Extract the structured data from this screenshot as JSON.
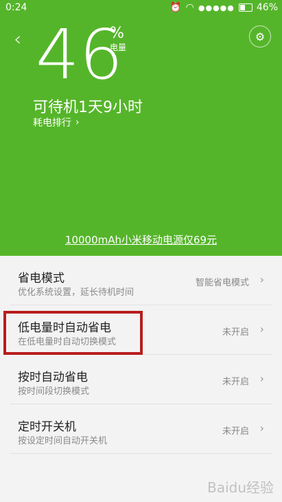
{
  "status_bar": {
    "time": "0:24",
    "signal_dots": "●●●●●",
    "battery": "46%"
  },
  "hero": {
    "battery_level": "46",
    "percent_sign": "%",
    "percent_label": "电量",
    "standby_time": "可待机1天9小时",
    "rank_link": "耗电排行",
    "promo": "10000mAh小米移动电源仅69元"
  },
  "list": [
    {
      "title": "省电模式",
      "sub": "优化系统设置，延长待机时间",
      "value": "智能省电模式"
    },
    {
      "title": "低电量时自动省电",
      "sub": "在低电量时自动切换模式",
      "value": "未开启"
    },
    {
      "title": "按时自动省电",
      "sub": "按时间段切换模式",
      "value": "未开启"
    },
    {
      "title": "定时开关机",
      "sub": "按设定时间自动开关机",
      "value": "未开启"
    }
  ],
  "watermark": "Baidu经验",
  "colors": {
    "accent": "#55b52a",
    "highlight": "#b81d1d"
  }
}
